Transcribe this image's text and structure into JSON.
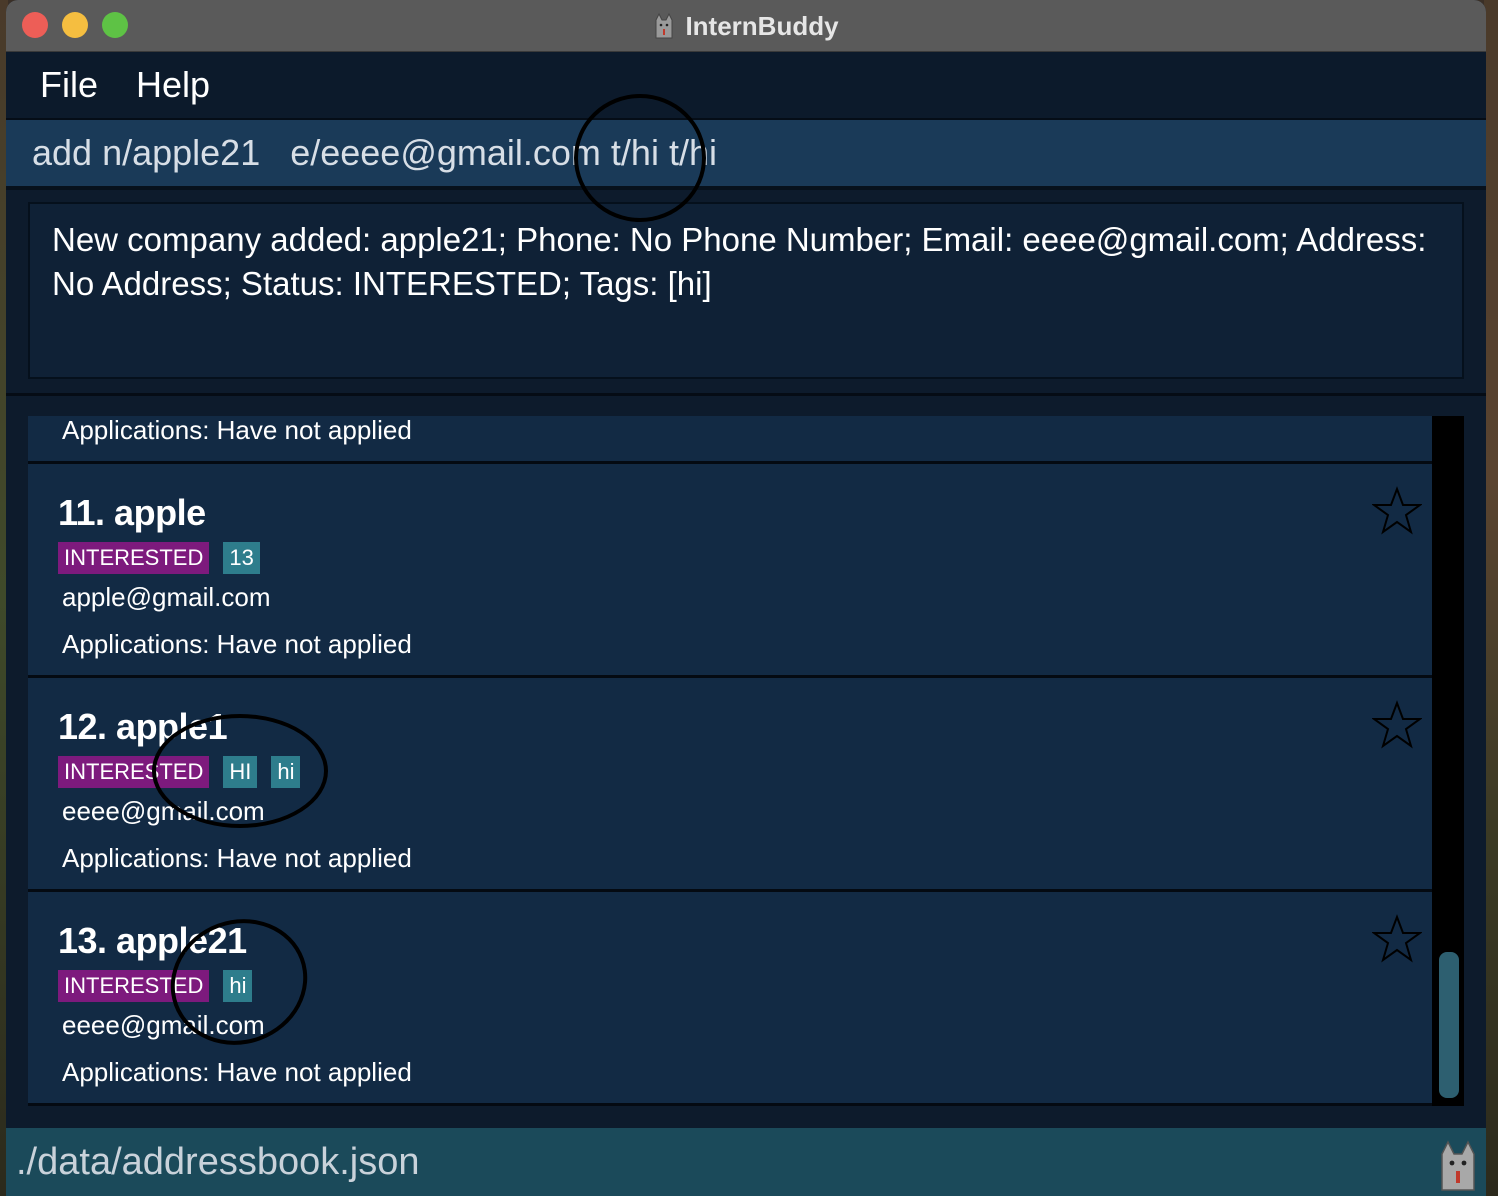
{
  "window": {
    "title": "InternBuddy",
    "app_icon": "cat-icon"
  },
  "menu": {
    "items": [
      "File",
      "Help"
    ]
  },
  "command_box": {
    "value": "add n/apple21   e/eeee@gmail.com t/hi t/hi"
  },
  "result": {
    "text": "New company added: apple21; Phone: No Phone Number; Email: eeee@gmail.com; Address: No Address; Status: INTERESTED; Tags: [hi]"
  },
  "list": {
    "cards": [
      {
        "name": "",
        "status": "",
        "tags": [],
        "email": "",
        "applications": "Applications: Have not applied",
        "partial": true
      },
      {
        "name": "11. apple",
        "status": "INTERESTED",
        "tags": [
          "13"
        ],
        "email": "apple@gmail.com",
        "applications": "Applications: Have not applied"
      },
      {
        "name": "12. apple1",
        "status": "INTERESTED",
        "tags": [
          "HI",
          "hi"
        ],
        "email": "eeee@gmail.com",
        "applications": "Applications: Have not applied"
      },
      {
        "name": "13. apple21",
        "status": "INTERESTED",
        "tags": [
          "hi"
        ],
        "email": "eeee@gmail.com",
        "applications": "Applications: Have not applied"
      }
    ],
    "star_icon": "star-outline-icon"
  },
  "statusbar": {
    "path": "./data/addressbook.json",
    "icon": "cat-icon"
  },
  "colors": {
    "status_badge": "#7d1a7d",
    "tag_badge": "#2e7d8c",
    "card_bg": "#122a44",
    "command_bg": "#1a3a58",
    "statusbar_bg": "#1b4a5a"
  }
}
